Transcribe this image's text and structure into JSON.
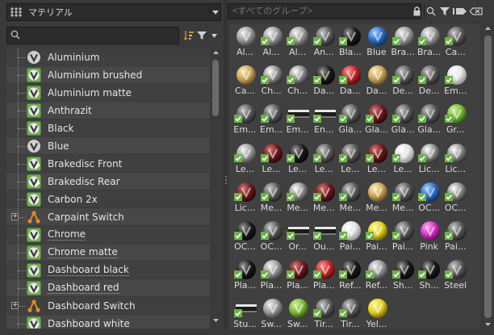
{
  "category": {
    "selected": "マテリアル",
    "icon": "library-grid-icon"
  },
  "left_search": {
    "placeholder": "",
    "value": ""
  },
  "right_search": {
    "placeholder": "<すべてのグループ>",
    "value": ""
  },
  "colors": {
    "check_green": "#6fb04a",
    "accent_orange": "#e08a2a",
    "bg": "#3a3a3a",
    "list_bg": "#404040"
  },
  "materials": [
    {
      "label": "Aluminium",
      "icon": "vred-v-icon",
      "checked": false,
      "expandable": false
    },
    {
      "label": "Aluminium brushed",
      "icon": "vred-v-check-icon",
      "checked": true,
      "expandable": false
    },
    {
      "label": "Aluminium matte",
      "icon": "vred-v-check-icon",
      "checked": true,
      "expandable": false
    },
    {
      "label": "Anthrazit",
      "icon": "vred-v-check-icon",
      "checked": true,
      "expandable": false
    },
    {
      "label": "Black",
      "icon": "vred-v-check-icon",
      "checked": true,
      "expandable": false
    },
    {
      "label": "Blue",
      "icon": "vred-v-icon",
      "checked": false,
      "expandable": false
    },
    {
      "label": "Brakedisc Front",
      "icon": "pencil-check-icon",
      "checked": true,
      "expandable": false
    },
    {
      "label": "Brakedisc Rear",
      "icon": "pencil-check-icon",
      "checked": true,
      "expandable": false
    },
    {
      "label": "Carbon 2x",
      "icon": "vred-v-check-icon",
      "checked": true,
      "expandable": false
    },
    {
      "label": "Carpaint Switch",
      "icon": "switch-node-icon",
      "checked": false,
      "expandable": true
    },
    {
      "label": "Chrome",
      "icon": "vred-v-check-icon",
      "checked": true,
      "expandable": false,
      "underline": true
    },
    {
      "label": "Chrome matte",
      "icon": "vred-v-check-icon",
      "checked": true,
      "expandable": false,
      "underline": true
    },
    {
      "label": "Dashboard black",
      "icon": "vred-v-check-icon",
      "checked": true,
      "expandable": false,
      "underline": true
    },
    {
      "label": "Dashboard red",
      "icon": "vred-v-check-icon",
      "checked": true,
      "expandable": false,
      "underline": true
    },
    {
      "label": "Dashboard Switch",
      "icon": "switch-node-icon",
      "checked": false,
      "expandable": true
    },
    {
      "label": "Dashboard white",
      "icon": "vred-v-check-icon",
      "checked": true,
      "expandable": false
    }
  ],
  "thumbnails": [
    {
      "label": "Al...",
      "ball": "metal",
      "checked": false
    },
    {
      "label": "Al...",
      "ball": "metal",
      "checked": true
    },
    {
      "label": "Al...",
      "ball": "metal",
      "checked": true
    },
    {
      "label": "An...",
      "ball": "darkmetal",
      "checked": true
    },
    {
      "label": "Bla...",
      "ball": "black",
      "checked": true
    },
    {
      "label": "Blue",
      "ball": "blue",
      "checked": false
    },
    {
      "label": "Bra...",
      "ball": "metal",
      "checked": true
    },
    {
      "label": "Bra...",
      "ball": "metal",
      "checked": true
    },
    {
      "label": "Ca...",
      "ball": "darkmetal",
      "checked": true
    },
    {
      "label": "Ca...",
      "ball": "gold",
      "checked": false
    },
    {
      "label": "Ch...",
      "ball": "chrome",
      "checked": true
    },
    {
      "label": "Ch...",
      "ball": "chrome",
      "checked": true
    },
    {
      "label": "Da...",
      "ball": "black",
      "checked": true
    },
    {
      "label": "Da...",
      "ball": "red",
      "checked": true
    },
    {
      "label": "Da...",
      "ball": "gold",
      "checked": false
    },
    {
      "label": "De...",
      "ball": "darkmetal",
      "checked": true
    },
    {
      "label": "De...",
      "ball": "darkmetal",
      "checked": true
    },
    {
      "label": "Em...",
      "ball": "white",
      "checked": true
    },
    {
      "label": "Em...",
      "ball": "darkmetal",
      "checked": true
    },
    {
      "label": "Em...",
      "ball": "darkmetal",
      "checked": true
    },
    {
      "label": "Em...",
      "ball": "flat",
      "checked": true
    },
    {
      "label": "En...",
      "ball": "flat",
      "checked": true
    },
    {
      "label": "Gla...",
      "ball": "darkmetal",
      "checked": true
    },
    {
      "label": "Gla...",
      "ball": "darkred",
      "checked": true
    },
    {
      "label": "Gla...",
      "ball": "darkmetal",
      "checked": true
    },
    {
      "label": "Gla...",
      "ball": "darkmetal",
      "checked": true
    },
    {
      "label": "Gr...",
      "ball": "green",
      "checked": true
    },
    {
      "label": "Le...",
      "ball": "metal",
      "checked": true
    },
    {
      "label": "Le...",
      "ball": "darkred",
      "checked": true
    },
    {
      "label": "Le...",
      "ball": "black",
      "checked": true
    },
    {
      "label": "Le...",
      "ball": "darkmetal",
      "checked": true
    },
    {
      "label": "Le...",
      "ball": "darkmetal",
      "checked": true
    },
    {
      "label": "Le...",
      "ball": "darkred",
      "checked": true
    },
    {
      "label": "Le...",
      "ball": "white",
      "checked": true
    },
    {
      "label": "Lic...",
      "ball": "chrome",
      "checked": true
    },
    {
      "label": "Lic...",
      "ball": "chrome",
      "checked": true
    },
    {
      "label": "Lic...",
      "ball": "darkred",
      "checked": true
    },
    {
      "label": "Me...",
      "ball": "darkmetal",
      "checked": true
    },
    {
      "label": "Me...",
      "ball": "chrome",
      "checked": true
    },
    {
      "label": "Me...",
      "ball": "darkred",
      "checked": true
    },
    {
      "label": "Me...",
      "ball": "darkmetal",
      "checked": true
    },
    {
      "label": "Me...",
      "ball": "gold",
      "checked": false
    },
    {
      "label": "Me...",
      "ball": "darkmetal",
      "checked": true
    },
    {
      "label": "OC...",
      "ball": "blue",
      "checked": true
    },
    {
      "label": "OC...",
      "ball": "chrome",
      "checked": true
    },
    {
      "label": "OC...",
      "ball": "black",
      "checked": true
    },
    {
      "label": "OC...",
      "ball": "darkmetal",
      "checked": true
    },
    {
      "label": "Or...",
      "ball": "flat",
      "checked": true
    },
    {
      "label": "Ou...",
      "ball": "flat",
      "checked": true
    },
    {
      "label": "Pai...",
      "ball": "white",
      "checked": true
    },
    {
      "label": "Pai...",
      "ball": "yellow",
      "checked": true
    },
    {
      "label": "Pai...",
      "ball": "darkmetal",
      "checked": true
    },
    {
      "label": "Pink",
      "ball": "pink",
      "checked": false
    },
    {
      "label": "Pai...",
      "ball": "darkmetal",
      "checked": true
    },
    {
      "label": "Pla...",
      "ball": "black",
      "checked": true
    },
    {
      "label": "Pla...",
      "ball": "metal",
      "checked": true
    },
    {
      "label": "Pla...",
      "ball": "darkred",
      "checked": true
    },
    {
      "label": "Pla...",
      "ball": "red",
      "checked": true
    },
    {
      "label": "Ref...",
      "ball": "black",
      "checked": true
    },
    {
      "label": "Ref...",
      "ball": "metal",
      "checked": true
    },
    {
      "label": "Sh...",
      "ball": "black",
      "checked": true
    },
    {
      "label": "Sh...",
      "ball": "black",
      "checked": true
    },
    {
      "label": "Steel",
      "ball": "darkmetal",
      "checked": true
    },
    {
      "label": "Stu...",
      "ball": "flat",
      "checked": true
    },
    {
      "label": "Sw...",
      "ball": "metal",
      "checked": false
    },
    {
      "label": "Sw...",
      "ball": "green",
      "checked": false
    },
    {
      "label": "Tir...",
      "ball": "darkmetal",
      "checked": true
    },
    {
      "label": "Tir...",
      "ball": "darkmetal",
      "checked": true
    },
    {
      "label": "Yel...",
      "ball": "yellow",
      "checked": false
    }
  ]
}
